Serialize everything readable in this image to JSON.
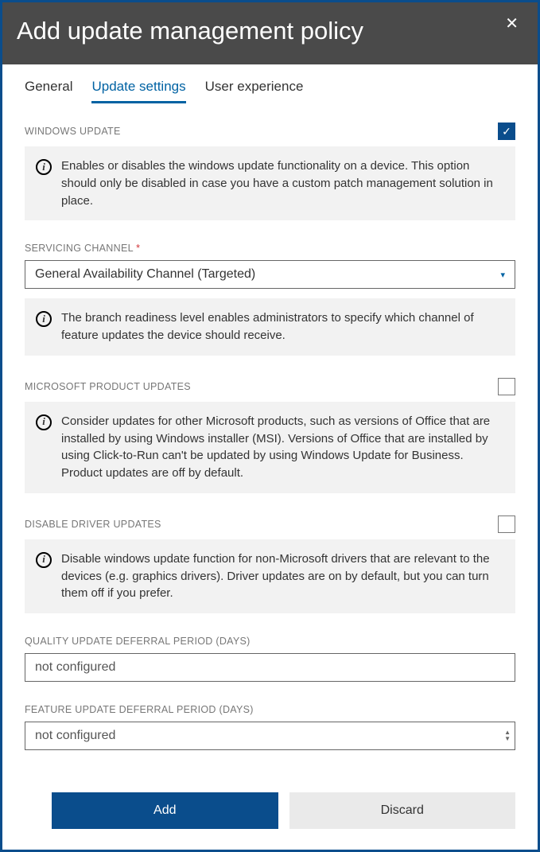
{
  "header": {
    "title": "Add update management policy"
  },
  "tabs": {
    "general": "General",
    "update_settings": "Update settings",
    "user_experience": "User experience"
  },
  "sections": {
    "windows_update": {
      "label": "WINDOWS UPDATE",
      "description": "Enables or disables the windows update functionality on a device. This option should only be disabled in case you have a custom patch management solution in place."
    },
    "servicing_channel": {
      "label": "SERVICING CHANNEL",
      "value": "General Availability Channel (Targeted)",
      "description": "The branch readiness level enables administrators to specify which channel of feature updates the device should receive."
    },
    "microsoft_product_updates": {
      "label": "MICROSOFT PRODUCT UPDATES",
      "description": "Consider updates for other Microsoft products, such as versions of Office that are installed by using Windows installer (MSI). Versions of Office that are installed by using Click-to-Run can't be updated by using Windows Update for Business. Product updates are off by default."
    },
    "disable_driver_updates": {
      "label": "DISABLE DRIVER UPDATES",
      "description": "Disable windows update function for non-Microsoft drivers that are relevant to the devices (e.g. graphics drivers). Driver updates are on by default, but you can turn them off if you prefer."
    },
    "quality_deferral": {
      "label": "QUALITY UPDATE DEFERRAL PERIOD (DAYS)",
      "value": "not configured"
    },
    "feature_deferral": {
      "label": "FEATURE UPDATE DEFERRAL PERIOD (DAYS)",
      "value": "not configured"
    }
  },
  "footer": {
    "add": "Add",
    "discard": "Discard"
  }
}
